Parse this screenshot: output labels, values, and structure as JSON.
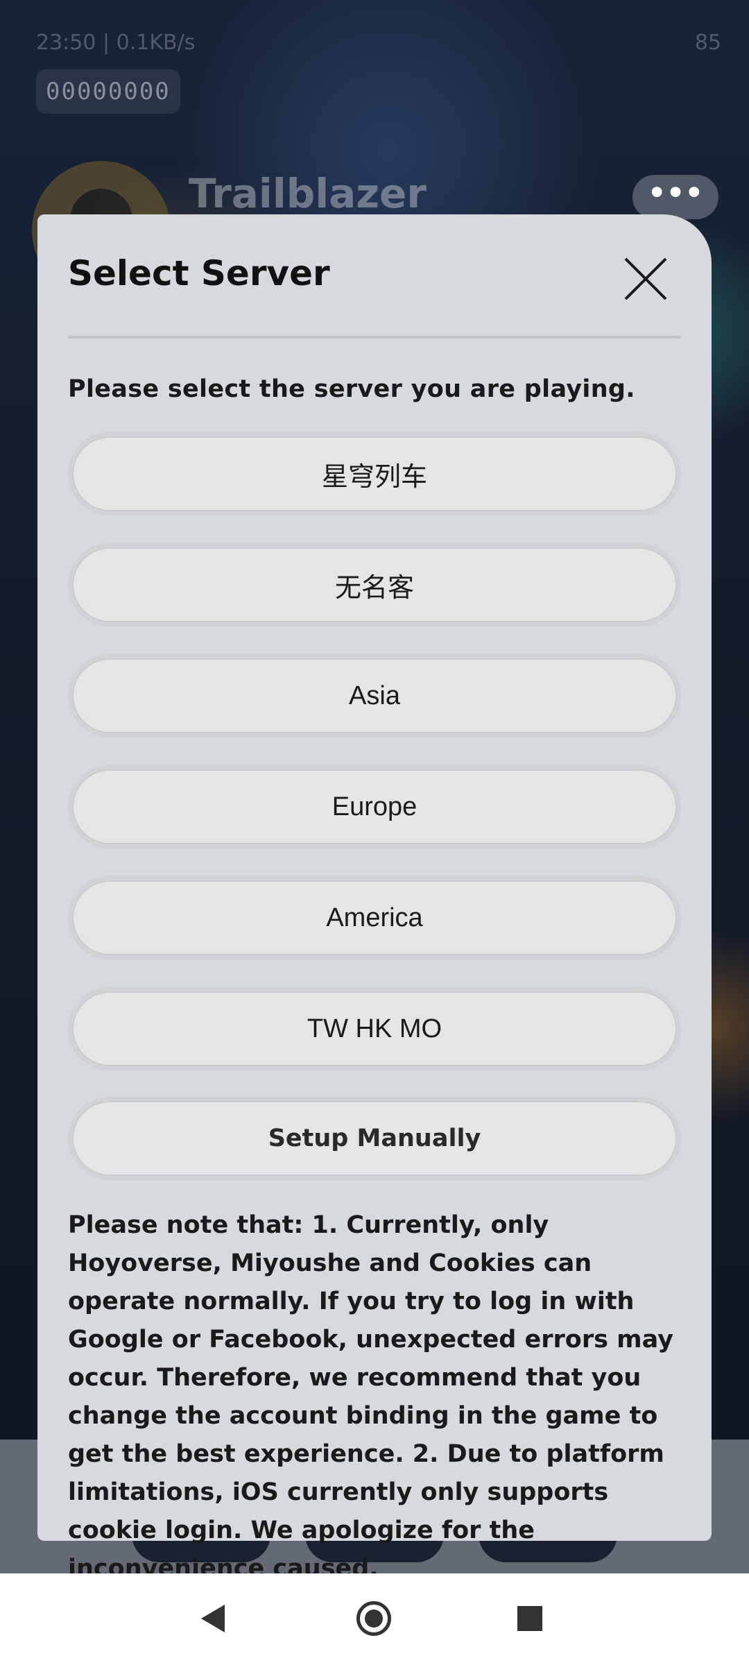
{
  "status_bar": {
    "time_and_speed": "23:50 | 0.1KB/s",
    "battery": "85"
  },
  "profile": {
    "uid": "00000000",
    "name": "Trailblazer",
    "more_label": "•••"
  },
  "dialog": {
    "title": "Select Server",
    "prompt": "Please select the server you are playing.",
    "servers": [
      {
        "label": "星穹列车"
      },
      {
        "label": "无名客"
      },
      {
        "label": "Asia"
      },
      {
        "label": "Europe"
      },
      {
        "label": "America"
      },
      {
        "label": "TW HK MO"
      },
      {
        "label": "Setup Manually"
      }
    ],
    "note": "Please note that: 1. Currently, only Hoyoverse, Miyoushe and Cookies can operate normally. If you try to log in with Google or Facebook, unexpected errors may occur. Therefore, we recommend that you change the account binding in the game to get the best experience. 2. Due to platform limitations, iOS currently only supports cookie login. We apologize for the inconvenience caused."
  },
  "icons": {
    "close": "close-icon",
    "back": "back-triangle-icon",
    "home": "home-circle-icon",
    "recent": "recent-square-icon"
  }
}
